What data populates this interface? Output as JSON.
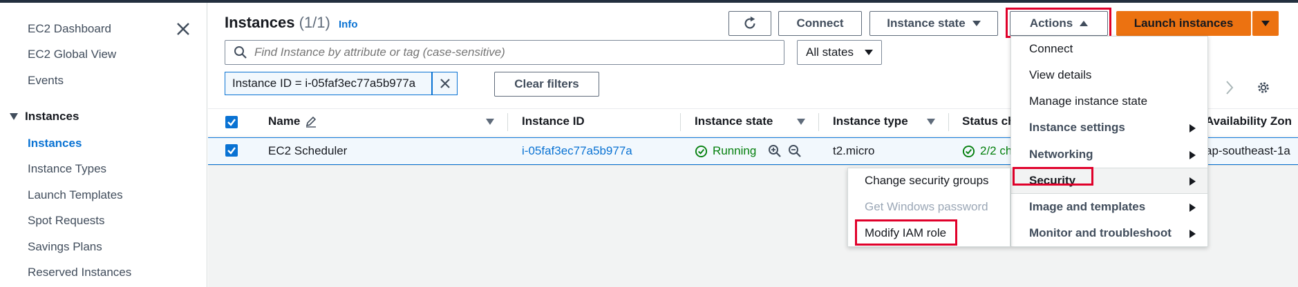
{
  "sidebar": {
    "items_top": [
      "EC2 Dashboard",
      "EC2 Global View",
      "Events"
    ],
    "section": "Instances",
    "items": [
      "Instances",
      "Instance Types",
      "Launch Templates",
      "Spot Requests",
      "Savings Plans",
      "Reserved Instances"
    ]
  },
  "header": {
    "title": "Instances",
    "count": "(1/1)",
    "info": "Info",
    "connect": "Connect",
    "instance_state": "Instance state",
    "actions": "Actions",
    "launch": "Launch instances"
  },
  "filters": {
    "search_placeholder": "Find Instance by attribute or tag (case-sensitive)",
    "state_select": "All states",
    "token": "Instance ID = i-05faf3ec77a5b977a",
    "clear": "Clear filters"
  },
  "table": {
    "columns": [
      "Name",
      "Instance ID",
      "Instance state",
      "Instance type",
      "Status ch",
      "Availability Zon"
    ],
    "row": {
      "name": "EC2 Scheduler",
      "instance_id": "i-05faf3ec77a5b977a",
      "state": "Running",
      "type": "t2.micro",
      "status": "2/2 ch",
      "zone": "ap-southeast-1a"
    }
  },
  "actions_menu": {
    "items": [
      "Connect",
      "View details",
      "Manage instance state",
      "Instance settings",
      "Networking",
      "Security",
      "Image and templates",
      "Monitor and troubleshoot"
    ]
  },
  "security_submenu": {
    "items": [
      "Change security groups",
      "Get Windows password",
      "Modify IAM role"
    ]
  },
  "colors": {
    "accent": "#0972d3",
    "primary": "#ec7211",
    "highlight": "#e0002a",
    "success": "#037f0c"
  }
}
